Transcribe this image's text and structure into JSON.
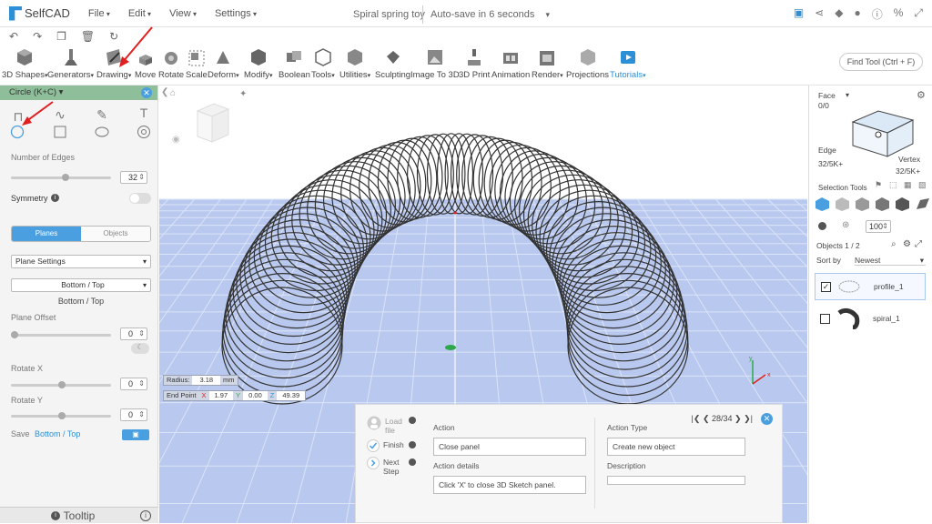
{
  "app": {
    "name": "SelfCAD",
    "doc_title": "Spiral spring toy",
    "autosave": "Auto-save in 6 seconds"
  },
  "menu": [
    "File",
    "Edit",
    "View",
    "Settings"
  ],
  "tools": [
    {
      "label": "3D Shapes",
      "caret": true
    },
    {
      "label": "Generators",
      "caret": true
    },
    {
      "label": "Drawing",
      "caret": true
    },
    {
      "label": "Move",
      "caret": false
    },
    {
      "label": "Rotate",
      "caret": false
    },
    {
      "label": "Scale",
      "caret": false
    },
    {
      "label": "Deform",
      "caret": true
    },
    {
      "label": "Modify",
      "caret": true
    },
    {
      "label": "Boolean",
      "caret": false
    },
    {
      "label": "Tools",
      "caret": true
    },
    {
      "label": "Utilities",
      "caret": true
    },
    {
      "label": "Sculpting",
      "caret": false
    },
    {
      "label": "Image To 3D",
      "caret": false
    },
    {
      "label": "3D Print",
      "caret": false
    },
    {
      "label": "Animation",
      "caret": false
    },
    {
      "label": "Render",
      "caret": true
    },
    {
      "label": "Projections",
      "caret": false
    },
    {
      "label": "Tutorials",
      "caret": true
    }
  ],
  "find_tool": "Find Tool (Ctrl + F)",
  "left_panel": {
    "header": "Circle (K+C)",
    "edges_label": "Number of Edges",
    "edges_value": "32",
    "symmetry_label": "Symmetry",
    "seg_planes": "Planes",
    "seg_objects": "Objects",
    "plane_settings": "Plane Settings",
    "plane_select": "Bottom / Top",
    "plane_current": "Bottom / Top",
    "plane_offset_label": "Plane Offset",
    "plane_offset_value": "0",
    "rotate_x_label": "Rotate X",
    "rotate_x_value": "0",
    "rotate_y_label": "Rotate Y",
    "rotate_y_value": "0",
    "save_label": "Save",
    "save_target": "Bottom / Top",
    "tooltip": "Tooltip"
  },
  "viewport": {
    "radius_label": "Radius:",
    "radius_value": "3.18",
    "radius_unit": "mm",
    "endpoint_label": "End Point",
    "x_label": "X",
    "x_value": "1.97",
    "y_label": "Y",
    "y_value": "0.00",
    "z_label": "Z",
    "z_value": "49.39",
    "axis_x": "x",
    "axis_y": "y"
  },
  "right_panel": {
    "face_label": "Face",
    "face_count": "0/0",
    "edge_label": "Edge",
    "edge_count": "32/5K+",
    "vertex_label": "Vertex",
    "vertex_count": "32/5K+",
    "selection_tools": "Selection Tools",
    "opacity_value": "100",
    "objects_label": "Objects 1 / 2",
    "sort_label": "Sort by",
    "sort_value": "Newest",
    "objects": [
      {
        "name": "profile_1",
        "checked": true
      },
      {
        "name": "spiral_1",
        "checked": false
      }
    ]
  },
  "tutorial": {
    "steps": [
      "Load file",
      "Finish",
      "Next Step"
    ],
    "action_label": "Action",
    "action_value": "Close panel",
    "action_details_label": "Action details",
    "action_details_value": "Click 'X' to close 3D Sketch panel.",
    "action_type_label": "Action Type",
    "action_type_value": "Create new object",
    "description_label": "Description",
    "description_value": "",
    "pager": "28/34"
  },
  "colors": {
    "accent": "#2d8fd5",
    "panel_header": "#8fbf9a",
    "viewport_floor": "#b9c8ee",
    "arrow": "#e02020"
  }
}
